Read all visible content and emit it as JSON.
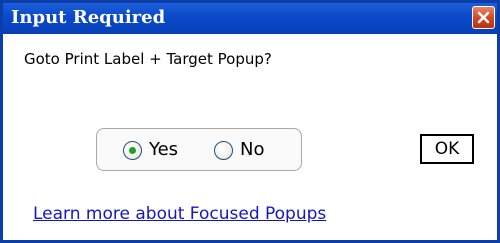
{
  "dialog": {
    "title": "Input Required",
    "question": "Goto Print Label + Target Popup?",
    "options": [
      {
        "label": "Yes",
        "selected": true
      },
      {
        "label": "No",
        "selected": false
      }
    ],
    "ok_label": "OK",
    "link_text": "Learn more about Focused Popups"
  },
  "icons": {
    "close": "close-icon",
    "radio": "radio-icon"
  },
  "colors": {
    "titlebar": "#0a49c9",
    "border": "#0b3ea8",
    "close_button": "#d0441f",
    "radio_selected_dot": "#21a121",
    "link": "#1515c8"
  }
}
